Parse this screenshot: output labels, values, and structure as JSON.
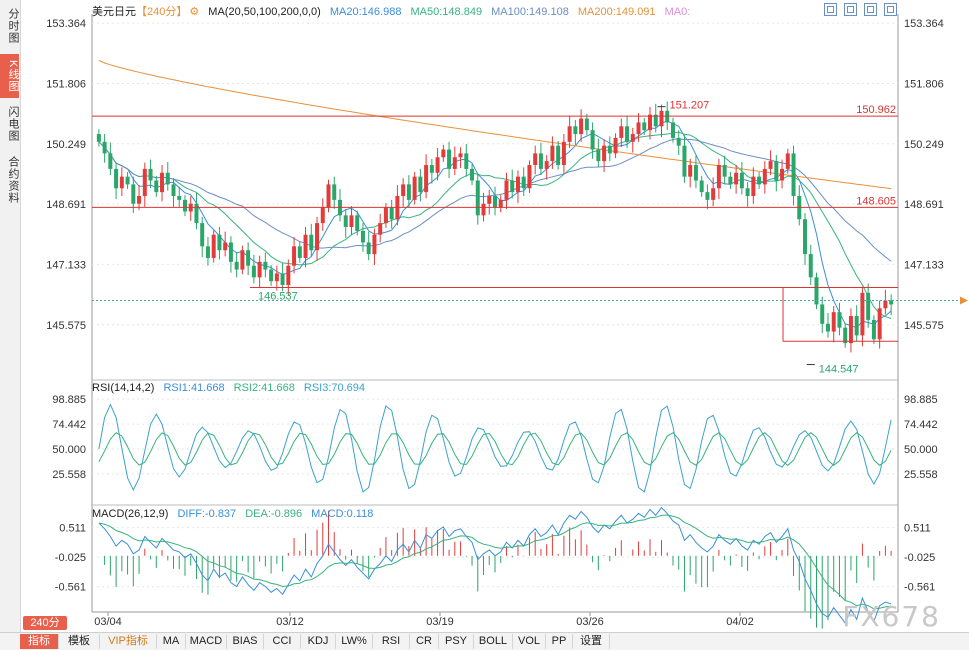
{
  "sidebar": {
    "tabs": [
      {
        "label": "分时图",
        "active": false
      },
      {
        "label": "K线图",
        "active": true
      },
      {
        "label": "闪电图",
        "active": false
      },
      {
        "label": "合约资料",
        "active": false
      }
    ]
  },
  "header": {
    "symbol": "美元日元",
    "period": "【240分】",
    "gear_icon": "gear-icon",
    "ma_params": "MA(20,50,100,200,0,0)",
    "ma20": "MA20:146.988",
    "ma50": "MA50:148.849",
    "ma100": "MA100:149.108",
    "ma200": "MA200:149.091",
    "ma0": "MA0:",
    "colors": {
      "ma20": "#3a8fd9",
      "ma50": "#37b37e",
      "ma100": "#6a8fc4",
      "ma200": "#e8913a",
      "ma0": "#d98fd9"
    }
  },
  "price_axis": {
    "ticks": [
      "153.364",
      "151.806",
      "150.249",
      "148.691",
      "147.133",
      "145.575"
    ]
  },
  "price_annotations": {
    "high": "151.207",
    "low": "144.547",
    "prev_low": "146.537",
    "level_1": "150.962",
    "level_2": "148.605"
  },
  "rsi": {
    "label": "RSI(14,14,2)",
    "rsi1": "RSI1:41.668",
    "rsi2": "RSI2:41.668",
    "rsi3": "RSI3:70.694",
    "ticks": [
      "98.885",
      "74.442",
      "50.000",
      "25.558"
    ]
  },
  "macd": {
    "label": "MACD(26,12,9)",
    "diff": "DIFF:-0.837",
    "dea": "DEA:-0.896",
    "macd": "MACD:0.118",
    "ticks": [
      "0.511",
      "-0.025",
      "-0.561"
    ]
  },
  "x_axis": {
    "dates": [
      "03/04",
      "03/12",
      "03/19",
      "03/26",
      "04/02"
    ]
  },
  "period_button": "240分",
  "bottom_tabs": [
    "指标",
    "模板",
    "VIP指标",
    "MA",
    "MACD",
    "BIAS",
    "CCI",
    "KDJ",
    "LW%",
    "RSI",
    "CR",
    "PSY",
    "BOLL",
    "VOL",
    "PP",
    "设置"
  ],
  "watermark": "FX678",
  "chart_data": {
    "type": "candlestick",
    "title": "美元日元【240分】",
    "y_ticks": [
      153.364,
      151.806,
      150.249,
      148.691,
      147.133,
      145.575
    ],
    "ylim": [
      144.2,
      153.6
    ],
    "x_tick_labels": [
      "03/04",
      "03/12",
      "03/19",
      "03/26",
      "04/02"
    ],
    "horizontal_levels": [
      150.962,
      148.605,
      146.537,
      144.547
    ],
    "series": [
      {
        "name": "MA20",
        "value": 146.988
      },
      {
        "name": "MA50",
        "value": 148.849
      },
      {
        "name": "MA100",
        "value": 149.108
      },
      {
        "name": "MA200",
        "value": 149.091
      }
    ],
    "close": [
      150.3,
      150.0,
      149.6,
      149.1,
      149.4,
      149.2,
      148.7,
      148.9,
      149.6,
      149.3,
      149.0,
      149.5,
      149.2,
      148.9,
      148.8,
      148.5,
      148.7,
      148.2,
      147.6,
      147.3,
      147.9,
      147.5,
      147.7,
      147.2,
      147.0,
      147.5,
      147.1,
      146.8,
      147.2,
      147.0,
      146.7,
      146.9,
      146.6,
      147.1,
      147.6,
      147.3,
      147.9,
      147.5,
      148.2,
      148.6,
      149.2,
      148.8,
      148.4,
      148.1,
      148.4,
      148.0,
      147.7,
      147.4,
      147.9,
      148.2,
      148.6,
      148.3,
      148.9,
      149.2,
      148.8,
      149.4,
      149.0,
      149.7,
      149.5,
      149.9,
      150.1,
      149.6,
      149.9,
      150.0,
      149.6,
      149.3,
      148.4,
      148.7,
      148.9,
      148.6,
      148.8,
      149.3,
      149.0,
      149.4,
      149.1,
      149.7,
      150.0,
      149.6,
      149.8,
      150.2,
      149.7,
      150.3,
      150.7,
      150.5,
      150.9,
      150.6,
      150.1,
      149.8,
      150.2,
      150.0,
      150.4,
      150.7,
      150.3,
      150.5,
      150.8,
      150.6,
      151.0,
      150.7,
      151.1,
      150.8,
      150.4,
      150.2,
      149.4,
      149.7,
      149.3,
      149.0,
      148.8,
      149.1,
      149.7,
      149.4,
      149.2,
      149.5,
      149.1,
      148.9,
      149.4,
      149.2,
      149.6,
      149.8,
      149.3,
      149.6,
      150.0,
      148.9,
      148.3,
      147.4,
      146.8,
      146.1,
      145.6,
      145.4,
      145.9,
      145.5,
      145.1,
      145.8,
      145.3,
      146.4,
      145.7,
      145.2,
      146.0,
      146.2,
      146.1
    ],
    "rsi_ticks": [
      98.885,
      74.442,
      50.0,
      25.558
    ],
    "rsi_values": {
      "RSI1": 41.668,
      "RSI2": 41.668,
      "RSI3": 70.694
    },
    "macd_ticks": [
      0.511,
      -0.025,
      -0.561
    ],
    "macd_values": {
      "DIFF": -0.837,
      "DEA": -0.896,
      "MACD": 0.118
    }
  }
}
